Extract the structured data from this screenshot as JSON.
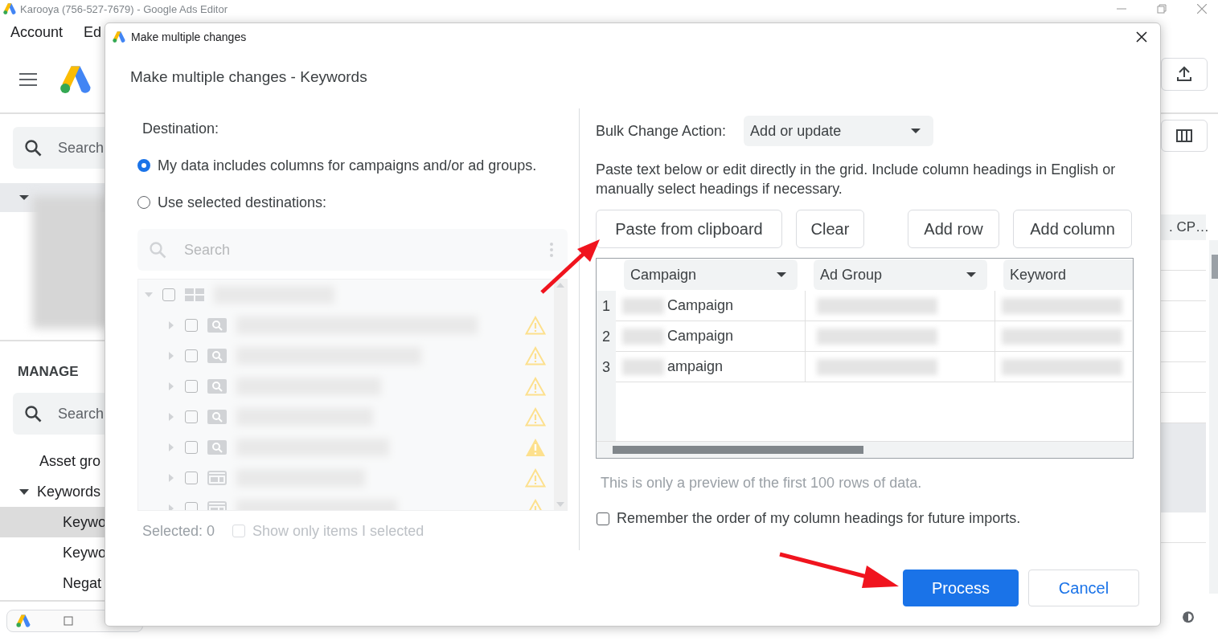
{
  "app": {
    "title": "Karooya (756-527-7679) - Google Ads Editor",
    "menu": [
      "Account",
      "Ed"
    ],
    "search_placeholder": "Search",
    "manage_heading": "MANAGE",
    "manage_search_placeholder": "Search",
    "nav": [
      {
        "label": "Asset gro",
        "selected": false
      },
      {
        "label": "Keywords",
        "selected": false,
        "expanded": true,
        "children": [
          {
            "label": "Keywo",
            "selected": true
          },
          {
            "label": "Keywo",
            "selected": false
          },
          {
            "label": "Negat",
            "selected": false
          }
        ]
      }
    ],
    "column_header": ". CP…"
  },
  "dialog": {
    "title": "Make multiple changes",
    "heading": "Make multiple changes - Keywords",
    "destination_label": "Destination:",
    "destination_options": [
      {
        "label": "My data includes columns for campaigns and/or ad groups.",
        "selected": true
      },
      {
        "label": "Use selected destinations:",
        "selected": false
      }
    ],
    "tree": {
      "disabled": true,
      "search_placeholder": "Search",
      "root": {
        "kind": "account",
        "expanded": true,
        "checked": false,
        "children": [
          {
            "kind": "search",
            "expanded": false,
            "checked": false,
            "warning": true,
            "warning_filled": false
          },
          {
            "kind": "search",
            "expanded": false,
            "checked": false,
            "warning": true,
            "warning_filled": false
          },
          {
            "kind": "search",
            "expanded": false,
            "checked": false,
            "warning": true,
            "warning_filled": false
          },
          {
            "kind": "search",
            "expanded": false,
            "checked": false,
            "warning": true,
            "warning_filled": false
          },
          {
            "kind": "search",
            "expanded": false,
            "checked": false,
            "warning": true,
            "warning_filled": true
          },
          {
            "kind": "display",
            "expanded": false,
            "checked": false,
            "warning": true,
            "warning_filled": false
          },
          {
            "kind": "display",
            "expanded": false,
            "checked": false,
            "warning": true,
            "warning_filled": false
          }
        ]
      }
    },
    "selected_count": "Selected: 0",
    "show_only_selected": {
      "label": "Show only items I selected",
      "checked": false,
      "disabled": true
    },
    "bulk_action": {
      "label": "Bulk Change Action:",
      "value": "Add or update"
    },
    "instructions": "Paste text below or edit directly in the grid. Include column headings in English or manually select headings if necessary.",
    "buttons": [
      "Paste from clipboard",
      "Clear",
      "Add row",
      "Add column"
    ],
    "grid": {
      "columns": [
        {
          "label": "Campaign"
        },
        {
          "label": "Ad Group"
        },
        {
          "label": "Keyword"
        }
      ],
      "rows": [
        {
          "number": "1",
          "campaign": "Campaign"
        },
        {
          "number": "2",
          "campaign": "Campaign"
        },
        {
          "number": "3",
          "campaign": "ampaign"
        }
      ]
    },
    "preview_note": "This is only a preview of the first 100 rows of data.",
    "remember_order": {
      "label": "Remember the order of my column headings for future imports.",
      "checked": false
    },
    "actions": [
      {
        "label": "Process",
        "kind": "primary"
      },
      {
        "label": "Cancel",
        "kind": "secondary"
      }
    ]
  }
}
